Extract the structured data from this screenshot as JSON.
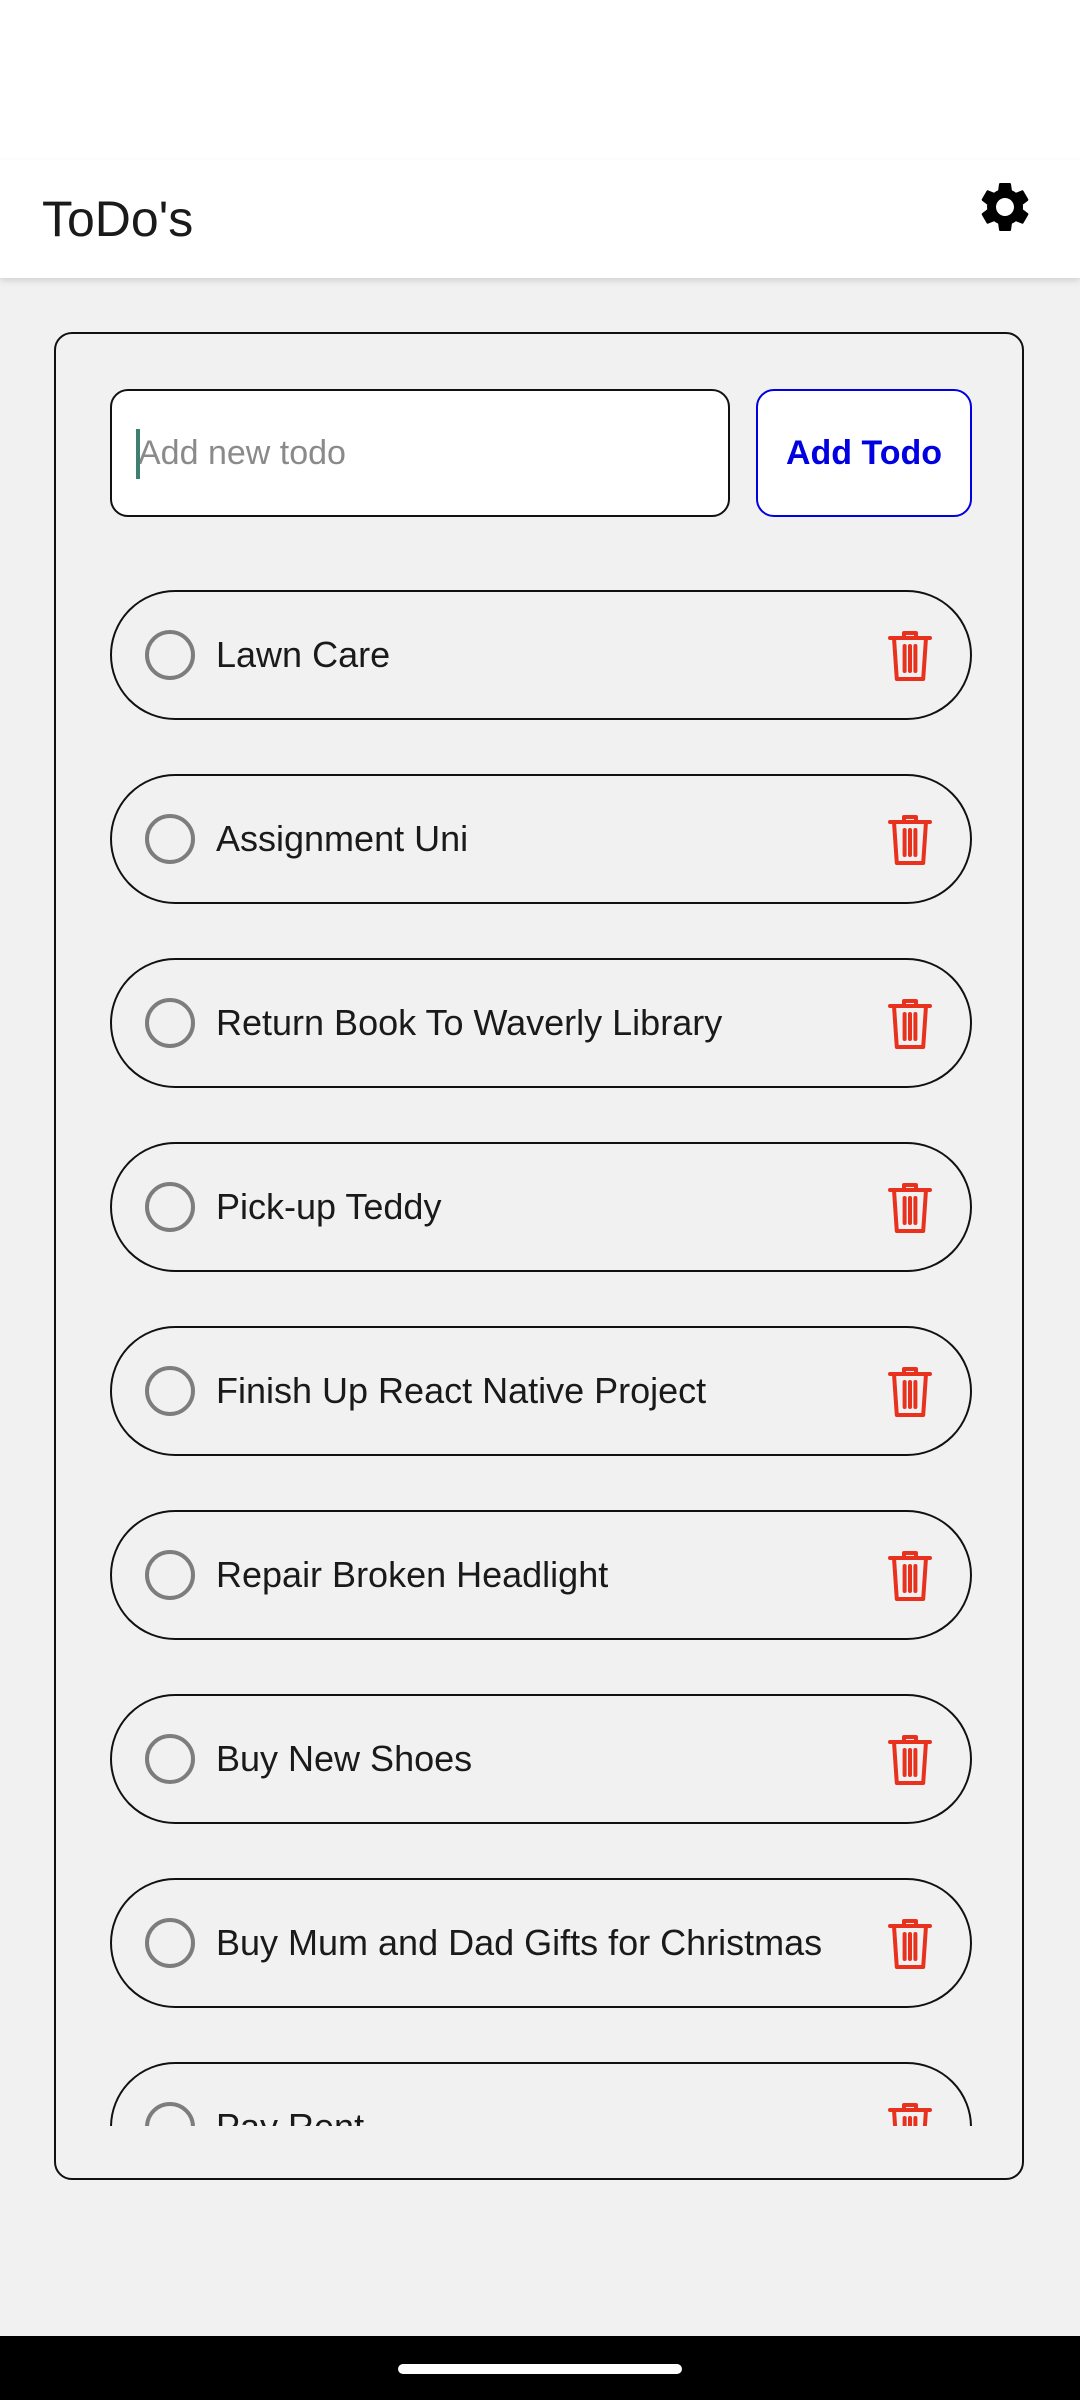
{
  "header": {
    "title": "ToDo's",
    "settings_icon": "gear-icon"
  },
  "new_todo": {
    "placeholder": "Add new todo",
    "value": "",
    "add_label": "Add Todo"
  },
  "todos": [
    {
      "text": "Lawn Care",
      "completed": false
    },
    {
      "text": "Assignment Uni",
      "completed": false
    },
    {
      "text": "Return Book To Waverly Library",
      "completed": false
    },
    {
      "text": "Pick-up Teddy",
      "completed": false
    },
    {
      "text": "Finish Up React Native Project",
      "completed": false
    },
    {
      "text": "Repair Broken Headlight",
      "completed": false
    },
    {
      "text": "Buy New Shoes",
      "completed": false
    },
    {
      "text": "Buy Mum and Dad Gifts for Christmas",
      "completed": false
    },
    {
      "text": "Pay Rent",
      "completed": false
    }
  ],
  "colors": {
    "accent": "#0000e0",
    "delete": "#e8321e",
    "background": "#f1f1f1"
  }
}
